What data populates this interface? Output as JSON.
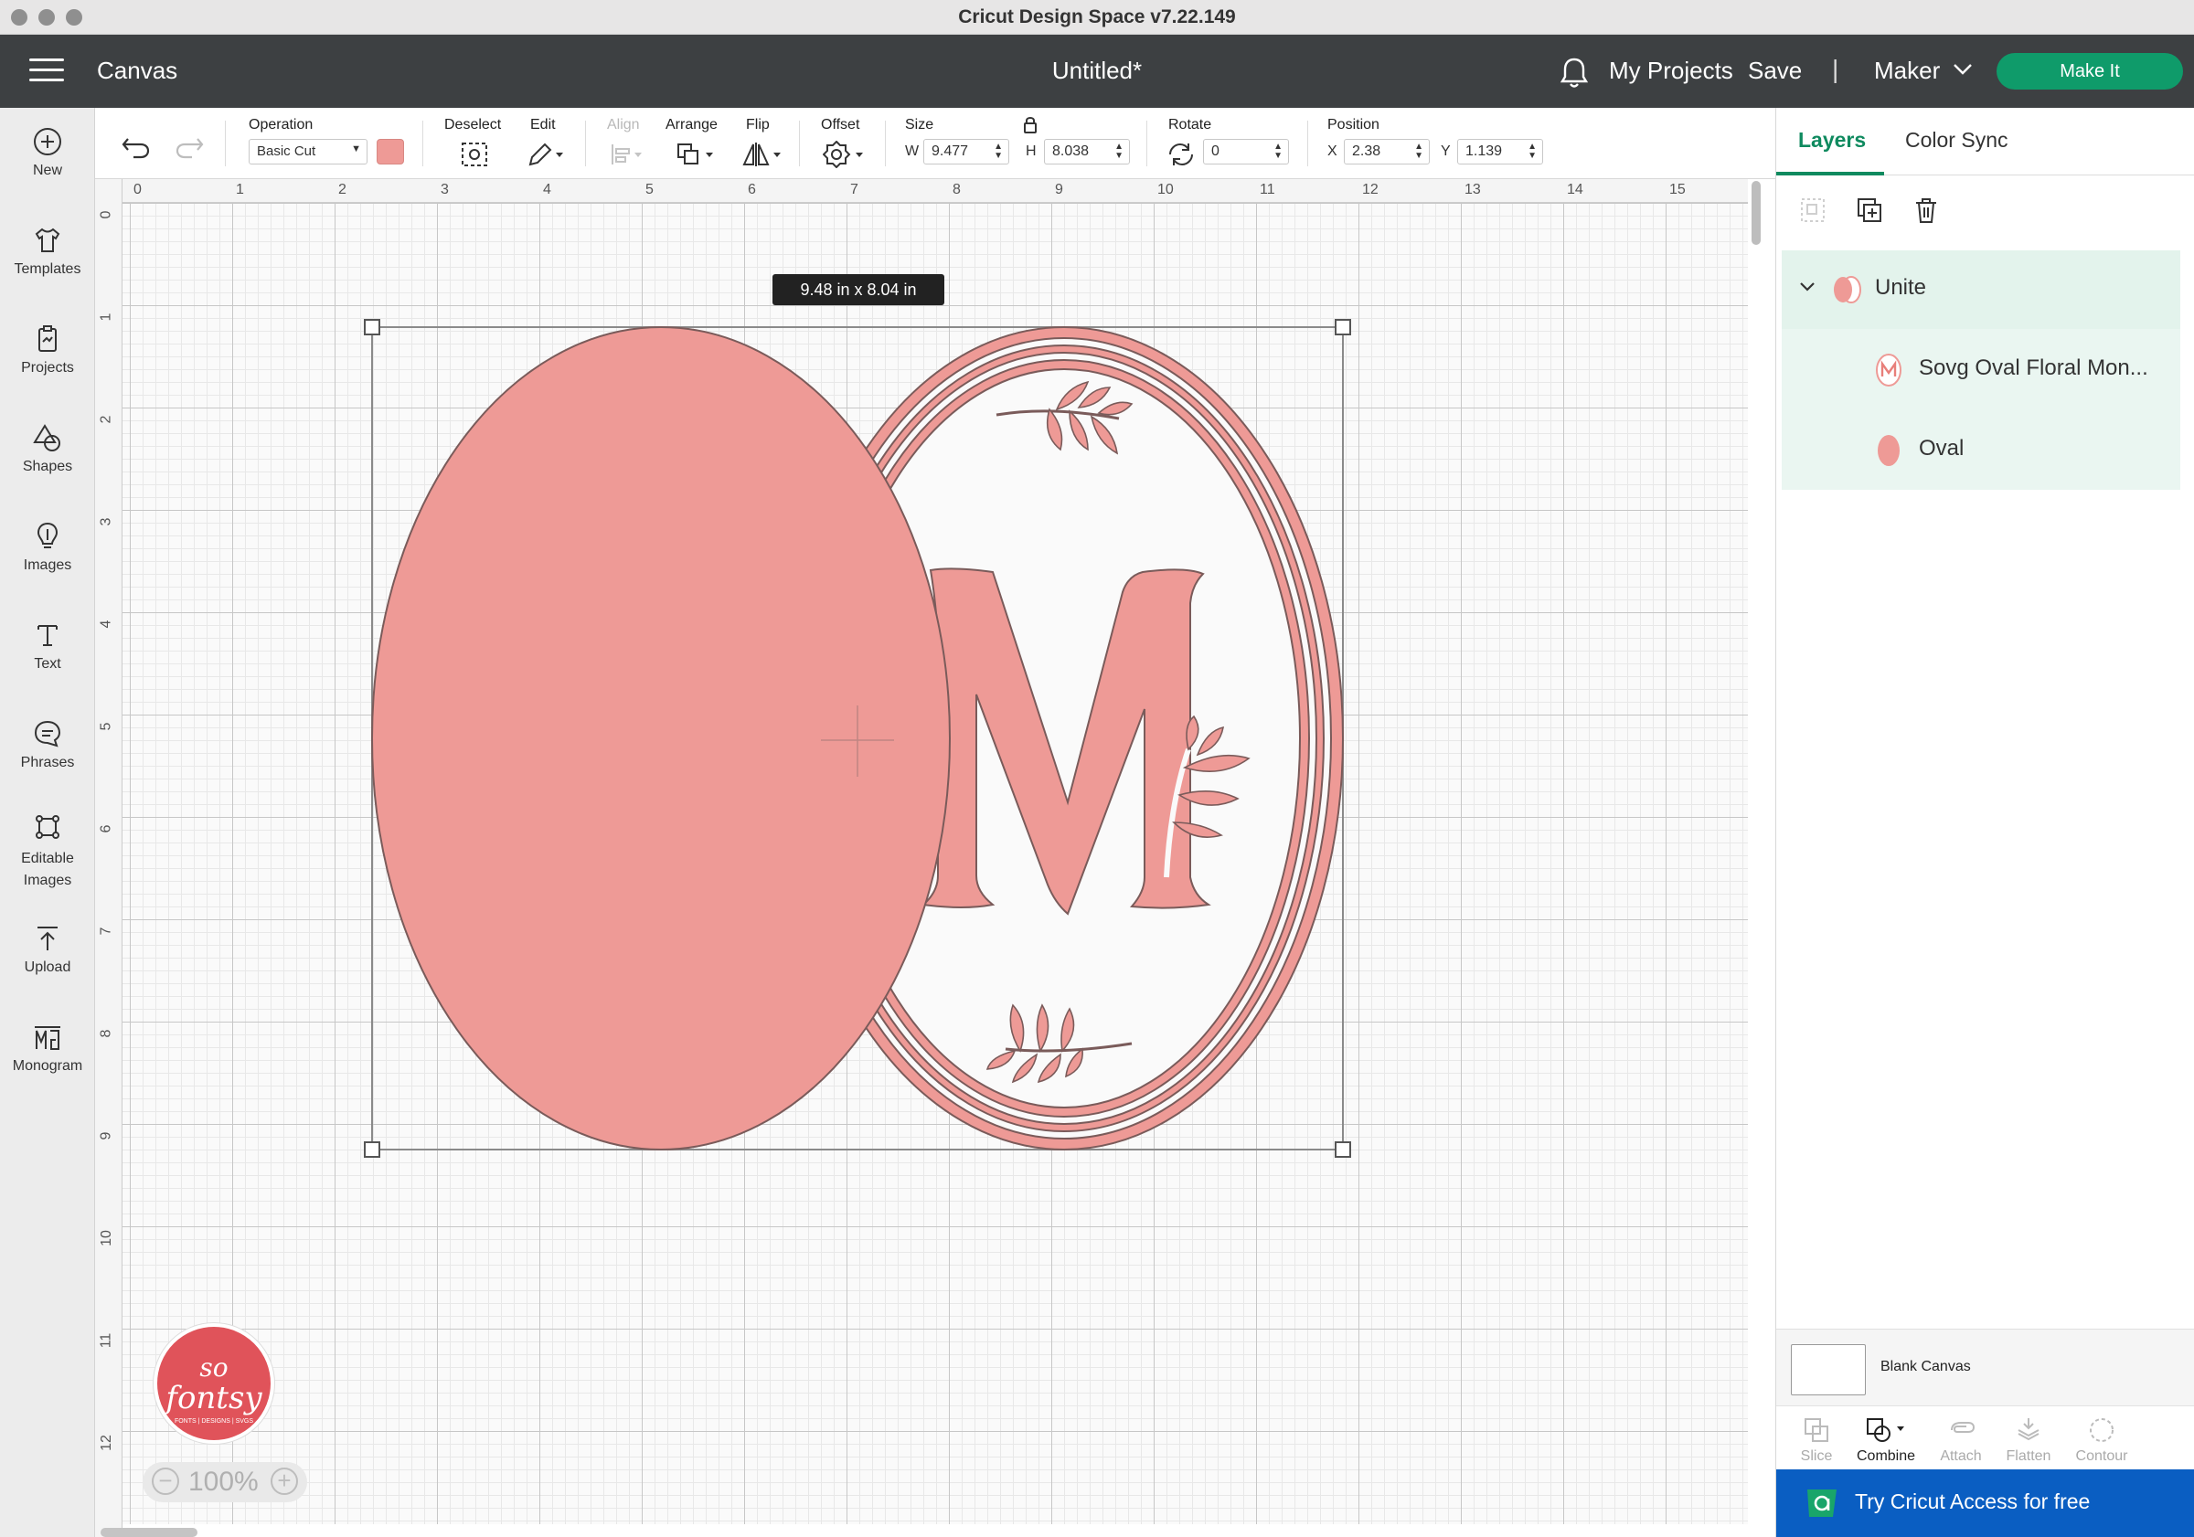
{
  "window": {
    "title": "Cricut Design Space  v7.22.149"
  },
  "header": {
    "section": "Canvas",
    "doc_title": "Untitled*",
    "my_projects": "My Projects",
    "save": "Save",
    "separator": "|",
    "machine": "Maker",
    "make_it": "Make It"
  },
  "sidebar": {
    "items": [
      {
        "label": "New",
        "icon": "plus-circle-icon"
      },
      {
        "label": "Templates",
        "icon": "shirt-icon"
      },
      {
        "label": "Projects",
        "icon": "clipboard-icon"
      },
      {
        "label": "Shapes",
        "icon": "shapes-icon"
      },
      {
        "label": "Images",
        "icon": "lightbulb-icon"
      },
      {
        "label": "Text",
        "icon": "text-icon"
      },
      {
        "label": "Phrases",
        "icon": "speech-bubble-icon"
      },
      {
        "label": "Editable Images",
        "icon": "editable-image-icon"
      },
      {
        "label": "Upload",
        "icon": "upload-icon"
      },
      {
        "label": "Monogram",
        "icon": "monogram-icon"
      }
    ]
  },
  "toolbar": {
    "operation_label": "Operation",
    "operation_value": "Basic Cut",
    "operation_color": "#ee9a96",
    "deselect": "Deselect",
    "edit": "Edit",
    "align": "Align",
    "arrange": "Arrange",
    "flip": "Flip",
    "offset": "Offset",
    "size_label": "Size",
    "w_letter": "W",
    "w_value": "9.477",
    "h_letter": "H",
    "h_value": "8.038",
    "rotate_label": "Rotate",
    "rotate_value": "0",
    "position_label": "Position",
    "x_letter": "X",
    "x_value": "2.38",
    "y_letter": "Y",
    "y_value": "1.139"
  },
  "canvas": {
    "ruler_top": [
      "0",
      "1",
      "2",
      "3",
      "4",
      "5",
      "6",
      "7",
      "8",
      "9",
      "10",
      "11",
      "12",
      "13",
      "14",
      "15"
    ],
    "ruler_left": [
      "0",
      "1",
      "2",
      "3",
      "4",
      "5",
      "6",
      "7",
      "8",
      "9",
      "10",
      "11",
      "12"
    ],
    "dimension_tooltip": "9.48  in x 8.04  in",
    "zoom": "100%",
    "monogram_letter": "M",
    "shape_color": "#ee9a96"
  },
  "logo": {
    "line1": "so",
    "line2": "fontsy",
    "line3": "FONTS | DESIGNS | SVGS"
  },
  "right_panel": {
    "tabs": [
      "Layers",
      "Color Sync"
    ],
    "layers": [
      {
        "name": "Unite"
      },
      {
        "name": "Sovg Oval Floral Mon..."
      },
      {
        "name": "Oval"
      }
    ],
    "blank_canvas": "Blank Canvas",
    "bottom_tools": [
      "Slice",
      "Combine",
      "Attach",
      "Flatten",
      "Contour"
    ],
    "access_banner": "Try Cricut Access for free"
  },
  "colors": {
    "accent_green": "#0f9b6a",
    "header_dark": "#3d4042",
    "access_blue": "#0a5ec2",
    "shape_pink": "#ee9a96"
  }
}
